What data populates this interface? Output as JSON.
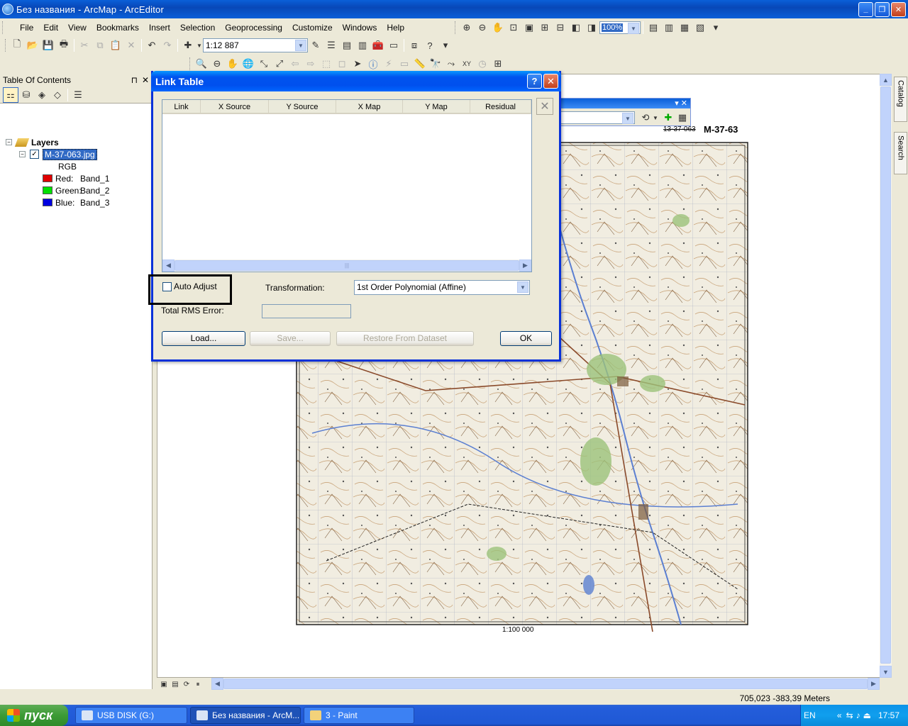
{
  "app": {
    "title": "Без названия - ArcMap - ArcEditor",
    "window_buttons": {
      "minimize": "_",
      "maximize": "❐",
      "close": "✕"
    }
  },
  "menu": [
    "File",
    "Edit",
    "View",
    "Bookmarks",
    "Insert",
    "Selection",
    "Geoprocessing",
    "Customize",
    "Windows",
    "Help"
  ],
  "toolbar": {
    "scale_value": "1:12 887",
    "zoom_value": "100%"
  },
  "toc": {
    "title": "Table Of Contents",
    "pin": "⊓",
    "close": "✕",
    "layers_label": "Layers",
    "layer_name": "M-37-063.jpg",
    "rgb_label": "RGB",
    "bands": [
      {
        "label": "Red:",
        "band": "Band_1",
        "color": "#e00000"
      },
      {
        "label": "Green:",
        "band": "Band_2",
        "color": "#00e000"
      },
      {
        "label": "Blue:",
        "band": "Band_3",
        "color": "#0000e0"
      }
    ]
  },
  "map": {
    "sheet_code_small": "13-37-063",
    "sheet_code": "M-37-63",
    "scale_text": "1:100 000"
  },
  "side_tabs": [
    "Catalog",
    "Search"
  ],
  "status": {
    "coordinates": "705,023  -383,39 Meters"
  },
  "dialog": {
    "title": "Link Table",
    "help": "?",
    "close": "✕",
    "columns": [
      "Link",
      "X Source",
      "Y Source",
      "X Map",
      "Y Map",
      "Residual"
    ],
    "auto_adjust_label": "Auto Adjust",
    "transformation_label": "Transformation:",
    "transformation_value": "1st Order Polynomial (Affine)",
    "rms_label": "Total RMS Error:",
    "rms_value": "",
    "buttons": {
      "load": "Load...",
      "save": "Save...",
      "restore": "Restore From Dataset",
      "ok": "OK"
    }
  },
  "taskbar": {
    "start": "пуск",
    "tasks": [
      "USB DISK (G:)",
      "Без названия - ArcM...",
      "3 - Paint"
    ],
    "lang": "EN",
    "time": "17:57"
  }
}
